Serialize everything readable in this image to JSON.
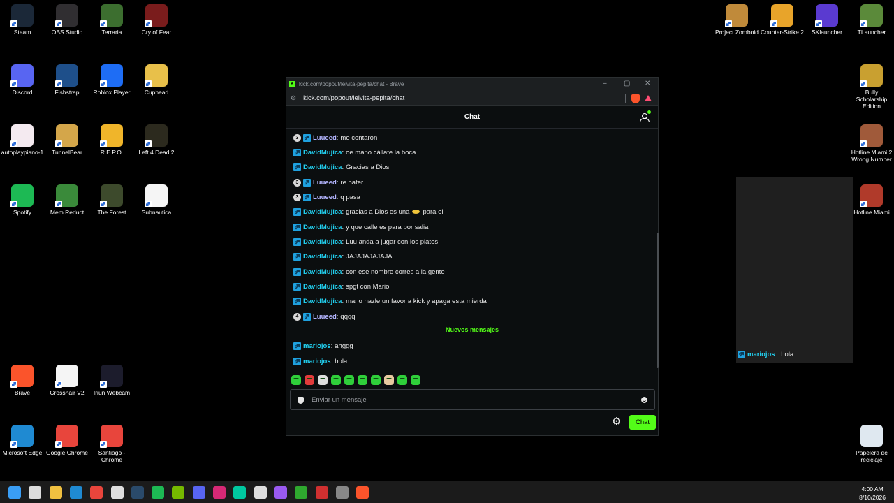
{
  "desktop": {
    "icons": [
      {
        "label": "Steam",
        "color": "#1b2838"
      },
      {
        "label": "OBS Studio",
        "color": "#302e31"
      },
      {
        "label": "Terraria",
        "color": "#3c6e2f"
      },
      {
        "label": "Cry of Fear",
        "color": "#7a1c1c"
      },
      {
        "label": "Discord",
        "color": "#5865f2"
      },
      {
        "label": "Fishstrap",
        "color": "#1e4f8a"
      },
      {
        "label": "Roblox Player",
        "color": "#1e6df5"
      },
      {
        "label": "Cuphead",
        "color": "#e8c04a"
      },
      {
        "label": "autoplaypiano-1",
        "color": "#f4eaf0"
      },
      {
        "label": "TunnelBear",
        "color": "#d4a64a"
      },
      {
        "label": "R.E.P.O.",
        "color": "#f0b52a"
      },
      {
        "label": "Left 4 Dead 2",
        "color": "#2c2a1e"
      },
      {
        "label": "Spotify",
        "color": "#1db954"
      },
      {
        "label": "Mem Reduct",
        "color": "#3a8a3a"
      },
      {
        "label": "The Forest",
        "color": "#3d4a2c"
      },
      {
        "label": "Subnautica",
        "color": "#f5f5f5"
      },
      {
        "label": "Brave",
        "color": "#fb542b"
      },
      {
        "label": "Crosshair V2",
        "color": "#f5f5f5"
      },
      {
        "label": "Iriun Webcam",
        "color": "#1c1c2c"
      },
      {
        "label": "Microsoft Edge",
        "color": "#1f8ad2"
      },
      {
        "label": "Google Chrome",
        "color": "#e8453c"
      },
      {
        "label": "Santiago - Chrome",
        "color": "#e8453c"
      },
      {
        "label": "Project Zomboid",
        "color": "#c08a3a"
      },
      {
        "label": "Counter-Strike 2",
        "color": "#e8a42a"
      },
      {
        "label": "SKlauncher",
        "color": "#5a3ad0"
      },
      {
        "label": "TLauncher",
        "color": "#5b8a3a"
      },
      {
        "label": "Bully Scholarship Edition",
        "color": "#c9a030"
      },
      {
        "label": "Hotline Miami 2 Wrong Number",
        "color": "#a05a3a"
      },
      {
        "label": "Hotline Miami",
        "color": "#b03a2a"
      },
      {
        "label": "Papelera de reciclaje",
        "color": "#dfe8f0"
      }
    ]
  },
  "browser": {
    "title": "kick.com/popout/leivita-pepita/chat - Brave",
    "url": "kick.com/popout/leivita-pepita/chat",
    "brave_badge": "0"
  },
  "chat": {
    "header": "Chat",
    "messages": [
      {
        "badge": "3",
        "user": "Luueed",
        "text": "me contaron"
      },
      {
        "badge": "sub",
        "user": "DavidMujica",
        "text": "oe mano cállate la boca"
      },
      {
        "badge": "sub",
        "user": "DavidMujica",
        "text": "Gracias a Dios"
      },
      {
        "badge": "3",
        "user": "Luueed",
        "text": "re hater"
      },
      {
        "badge": "3",
        "user": "Luueed",
        "text": "q pasa"
      },
      {
        "badge": "sub",
        "user": "DavidMujica",
        "text": "gracias a Dios es una",
        "text2": "para el"
      },
      {
        "badge": "sub",
        "user": "DavidMujica",
        "text": "y que calle es para por salia"
      },
      {
        "badge": "sub",
        "user": "DavidMujica",
        "text": "Luu anda a jugar con los platos"
      },
      {
        "badge": "sub",
        "user": "DavidMujica",
        "text": "JAJAJAJAJAJA"
      },
      {
        "badge": "sub",
        "user": "DavidMujica",
        "text": "con ese nombre corres a la gente"
      },
      {
        "badge": "sub",
        "user": "DavidMujica",
        "text": "spgt con Mario"
      },
      {
        "badge": "sub",
        "user": "DavidMujica",
        "text": "mano hazle un favor a kick y apaga esta mierda"
      },
      {
        "badge": "4",
        "user": "Luueed",
        "text": "qqqq"
      },
      {
        "badge": "sub",
        "user": "mariojos",
        "text": "ahggg"
      },
      {
        "badge": "sub",
        "user": "mariojos",
        "text": "hola"
      }
    ],
    "new_messages_label": "Nuevos mensajes",
    "input_placeholder": "Enviar un mensaje",
    "send_label": "Chat"
  },
  "overlay": {
    "user": "mariojos",
    "text": "hola"
  },
  "taskbar": {
    "time": "4:00 AM",
    "date": "8/10/2026"
  }
}
